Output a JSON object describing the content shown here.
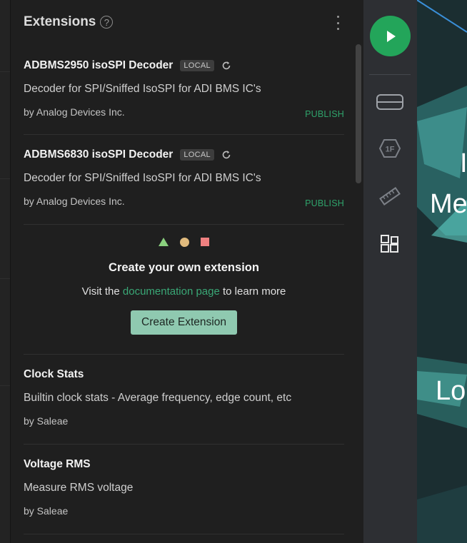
{
  "panel": {
    "title": "Extensions",
    "help_glyph": "?"
  },
  "extensions": [
    {
      "title": "ADBMS2950 isoSPI Decoder",
      "badge": "LOCAL",
      "description": "Decoder for SPI/Sniffed IsoSPI for ADI BMS IC's",
      "author": "by Analog Devices Inc.",
      "action": "PUBLISH"
    },
    {
      "title": "ADBMS6830 isoSPI Decoder",
      "badge": "LOCAL",
      "description": "Decoder for SPI/Sniffed IsoSPI for ADI BMS IC's",
      "author": "by Analog Devices Inc.",
      "action": "PUBLISH"
    },
    {
      "title": "Clock Stats",
      "description": "Builtin clock stats - Average frequency, edge count, etc",
      "author": "by Saleae"
    },
    {
      "title": "Voltage RMS",
      "description": "Measure RMS voltage",
      "author": "by Saleae"
    }
  ],
  "create": {
    "title": "Create your own extension",
    "text_before": "Visit the",
    "link_text": "documentation page",
    "text_after": "to learn more",
    "button_label": "Create Extension"
  },
  "sidebar": {
    "items": [
      {
        "name": "device",
        "icon": "device-icon"
      },
      {
        "name": "analyzers",
        "icon": "analyzer-1f-icon"
      },
      {
        "name": "measurements",
        "icon": "ruler-icon"
      },
      {
        "name": "extensions",
        "icon": "extensions-icon"
      }
    ],
    "play_icon": "play-icon"
  },
  "background": {
    "text_lines": [
      "I",
      "Me",
      "Lo"
    ]
  },
  "colors": {
    "accent_green": "#23a55a",
    "publish_green": "#2fa36b",
    "button_bg": "#8fc9b0",
    "triangle": "#8ad07e",
    "circle": "#e0ba7d",
    "square": "#ef8080"
  }
}
